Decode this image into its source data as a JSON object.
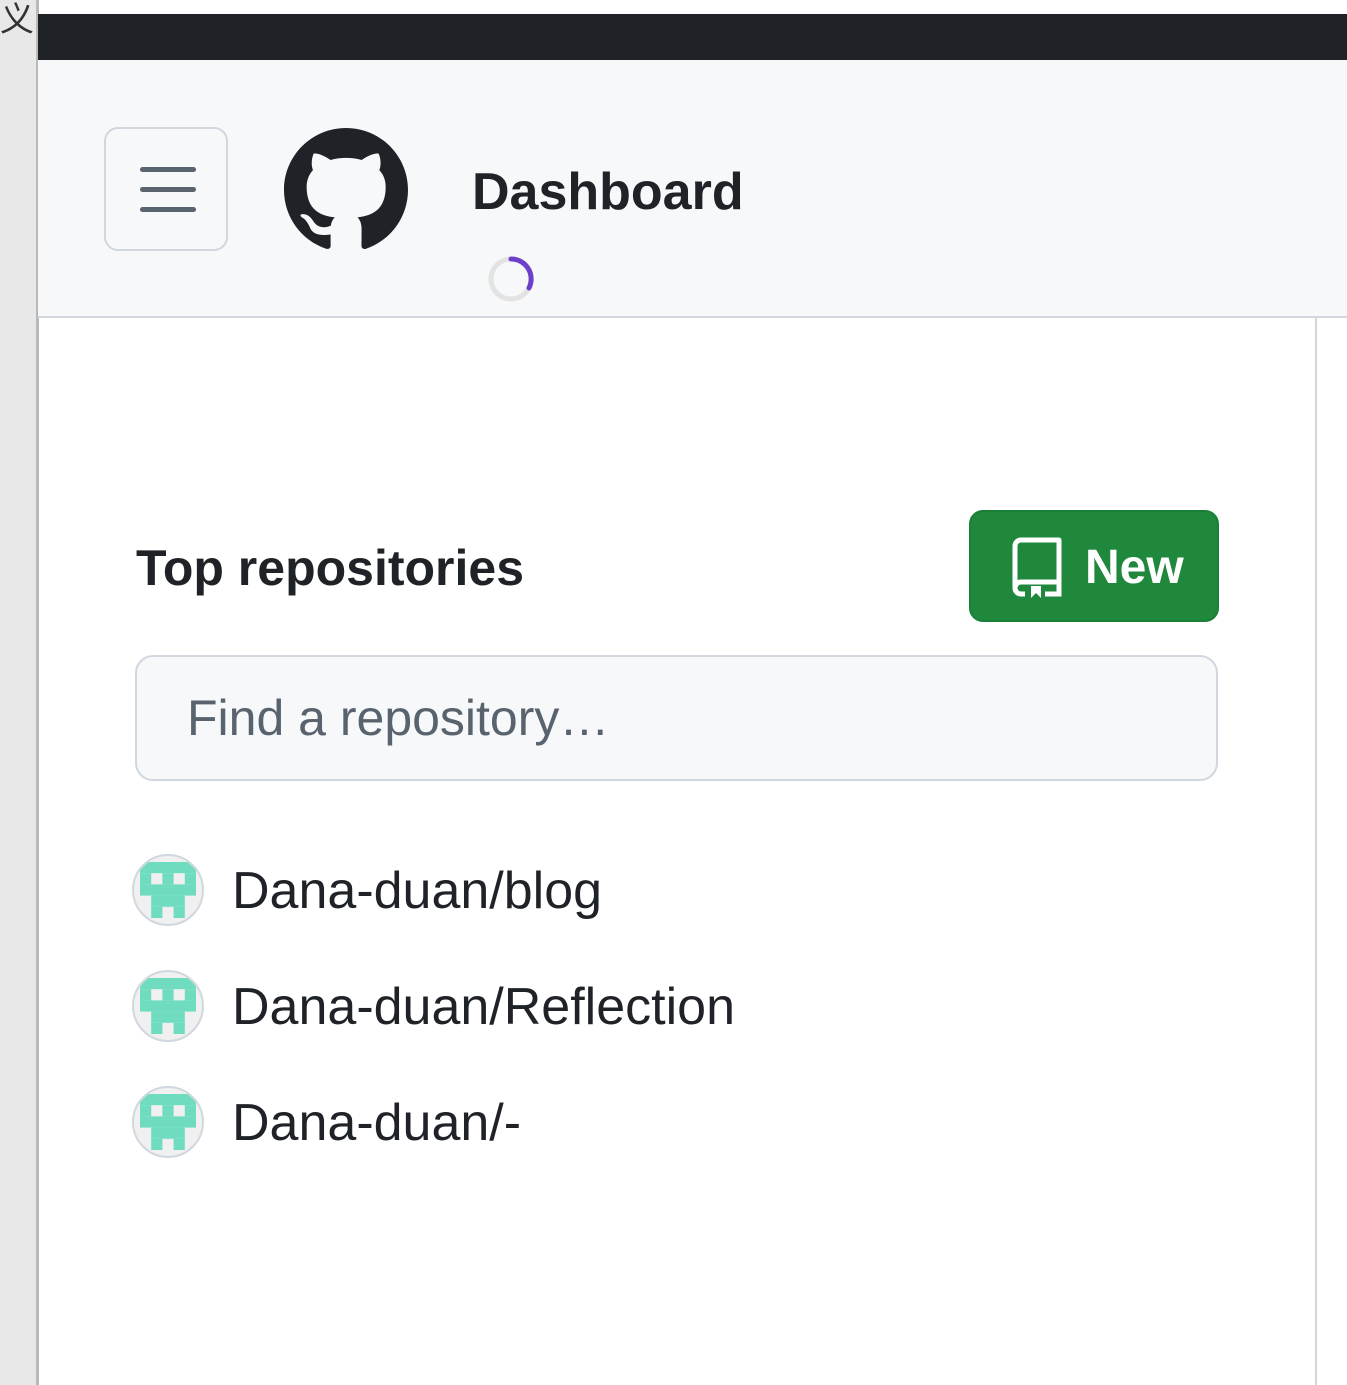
{
  "window": {
    "corner_glyph": "义",
    "top_bar_color": "#1f2328"
  },
  "header": {
    "menu_icon": "hamburger-icon",
    "logo_icon": "github-logo-icon",
    "title": "Dashboard",
    "loading_icon": "loading-spinner-icon"
  },
  "top_repositories": {
    "heading": "Top repositories",
    "new_button": {
      "label": "New",
      "icon": "repo-icon",
      "color": "#1f883d"
    },
    "search": {
      "placeholder": "Find a repository…",
      "value": ""
    },
    "repos": [
      {
        "name": "Dana-duan/blog",
        "avatar_icon": "identicon-avatar"
      },
      {
        "name": "Dana-duan/Reflection",
        "avatar_icon": "identicon-avatar"
      },
      {
        "name": "Dana-duan/-",
        "avatar_icon": "identicon-avatar"
      }
    ]
  },
  "colors": {
    "accent_green": "#1f883d",
    "header_bg": "#f6f8fa",
    "border": "#d0d7de",
    "identicon": "#6fdcc0",
    "spinner_accent": "#6e40c9"
  }
}
